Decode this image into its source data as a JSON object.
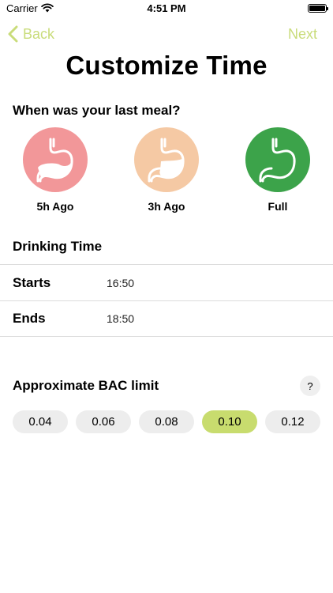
{
  "status_bar": {
    "carrier": "Carrier",
    "time": "4:51 PM",
    "icons": [
      "wifi-icon",
      "battery-icon"
    ]
  },
  "nav": {
    "back_label": "Back",
    "next_label": "Next",
    "accent_color": "#c9dc7a"
  },
  "page": {
    "title": "Customize Time"
  },
  "meal": {
    "question": "When was your last meal?",
    "options": [
      {
        "label": "5h Ago",
        "color": "#f29799",
        "icon": "stomach-icon"
      },
      {
        "label": "3h Ago",
        "color": "#f5c9a4",
        "icon": "stomach-icon"
      },
      {
        "label": "Full",
        "color": "#3ca34a",
        "icon": "stomach-icon",
        "selected": true
      }
    ]
  },
  "drinking": {
    "title": "Drinking Time",
    "rows": [
      {
        "label": "Starts",
        "value": "16:50"
      },
      {
        "label": "Ends",
        "value": "18:50"
      }
    ]
  },
  "bac": {
    "title": "Approximate BAC limit",
    "help_label": "?",
    "options": [
      "0.04",
      "0.06",
      "0.08",
      "0.10",
      "0.12"
    ],
    "selected": "0.10",
    "selected_color": "#c8dc6e"
  }
}
